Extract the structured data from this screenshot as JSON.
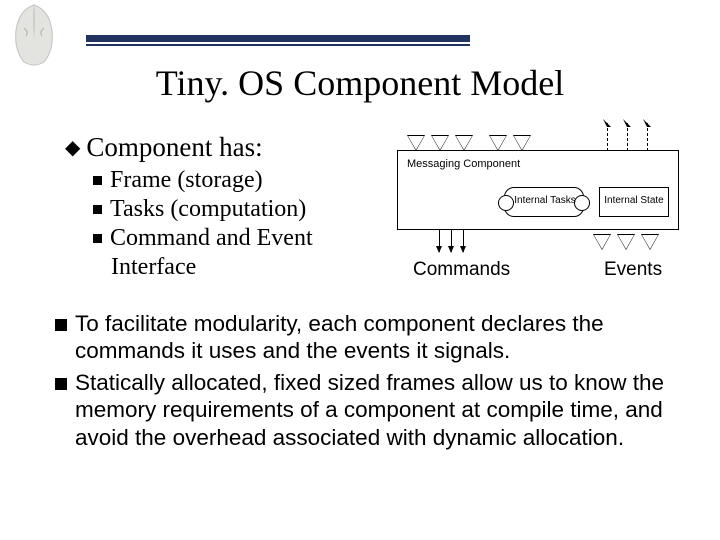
{
  "title": "Tiny. OS Component Model",
  "heading": "Component has:",
  "bullets": {
    "b1": "Frame (storage)",
    "b2": "Tasks (computation)",
    "b3_line1": "Command and Event",
    "b3_line2": "Interface"
  },
  "diagram": {
    "component_label": "Messaging Component",
    "tasks_label": "Internal Tasks",
    "state_label": "Internal State",
    "commands_label": "Commands",
    "events_label": "Events"
  },
  "lower": {
    "p1": "To facilitate modularity, each component declares the commands it uses and the events it signals.",
    "p2": "Statically allocated, fixed sized frames allow us to know the memory requirements of a component at compile time, and avoid the overhead associated with dynamic allocation."
  }
}
